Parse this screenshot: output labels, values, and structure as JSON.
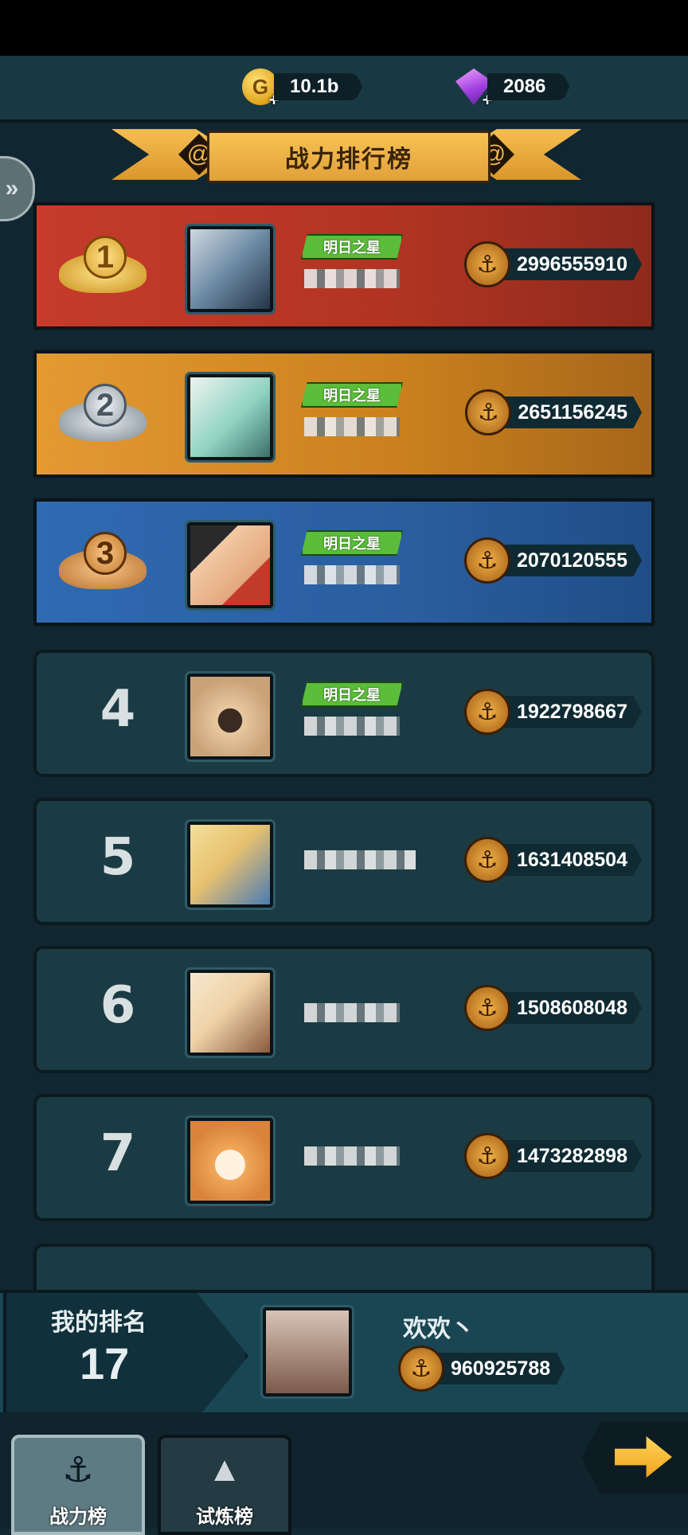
{
  "currencies": [
    {
      "name": "gold",
      "icon": "gold-coin-icon",
      "value": "10.1b"
    },
    {
      "name": "gem",
      "icon": "purple-gem-icon",
      "value": "2086"
    }
  ],
  "title": "战力排行榜",
  "leaderboard": [
    {
      "rank": "1",
      "tag": "明日之星",
      "power": "2996555910"
    },
    {
      "rank": "2",
      "tag": "明日之星",
      "power": "2651156245"
    },
    {
      "rank": "3",
      "tag": "明日之星",
      "power": "2070120555"
    },
    {
      "rank": "4",
      "tag": "明日之星",
      "power": "1922798667"
    },
    {
      "rank": "5",
      "tag": "",
      "power": "1631408504"
    },
    {
      "rank": "6",
      "tag": "",
      "power": "1508608048"
    },
    {
      "rank": "7",
      "tag": "",
      "power": "1473282898"
    }
  ],
  "my_rank": {
    "label": "我的排名",
    "value": "17",
    "name": "欢欢丶",
    "power": "960925788"
  },
  "tabs": [
    {
      "label": "战力榜",
      "icon": "anchor-icon",
      "active": true
    },
    {
      "label": "试炼榜",
      "icon": "triangle-trial-icon",
      "active": false
    }
  ],
  "colors": {
    "rank1": "#c63b2b",
    "rank2": "#e39a33",
    "rank3": "#2f6ab2",
    "default_row": "#1a3b43",
    "tag_green": "#5bbd3a"
  }
}
